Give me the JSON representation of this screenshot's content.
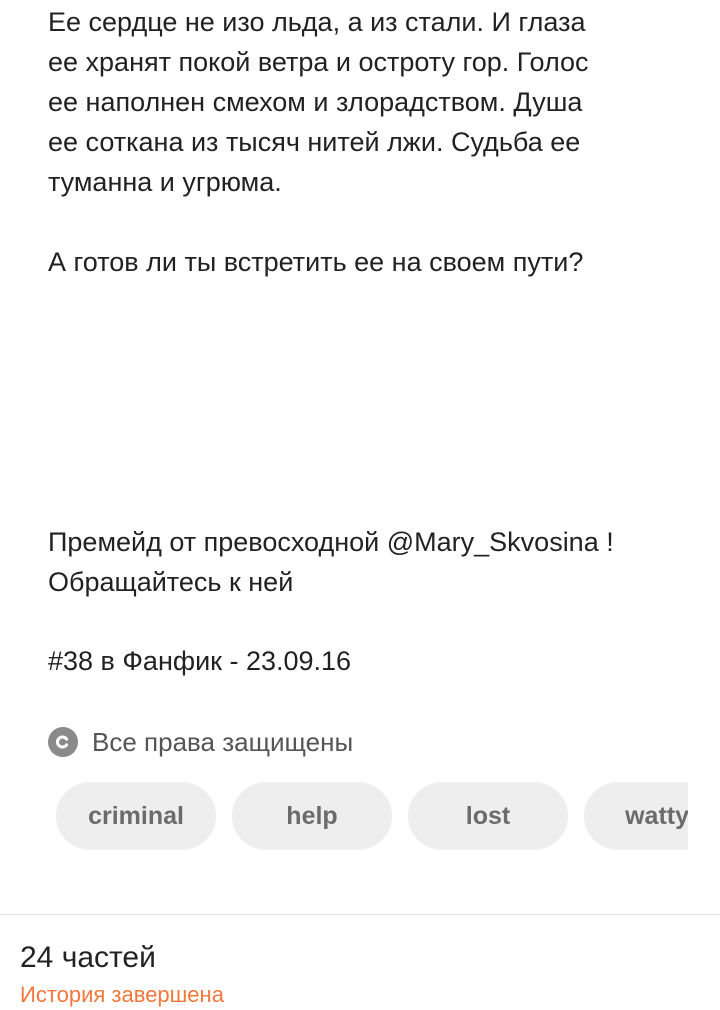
{
  "description": {
    "lines": [
      "Ее сердце не изо льда, а из стали. И глаза",
      "ее хранят покой ветра и остроту гор. Голос",
      "ее наполнен смехом и злорадством. Душа",
      "ее соткана из тысяч нитей лжи. Судьба ее",
      "туманна и угрюма."
    ],
    "question": "А готов ли ты встретить ее на своем пути?",
    "credit_lines": [
      "Премейд от превосходной @Mary_Skvosina !",
      "Обращайтесь к ней"
    ],
    "ranking": "#38 в Фанфик - 23.09.16"
  },
  "copyright": {
    "icon": "copyright-icon",
    "label": "Все права защищены"
  },
  "tags": [
    "criminal",
    "help",
    "lost",
    "wattys"
  ],
  "footer": {
    "parts": "24 частей",
    "status": "История завершена",
    "status_color": "#f2773c"
  }
}
